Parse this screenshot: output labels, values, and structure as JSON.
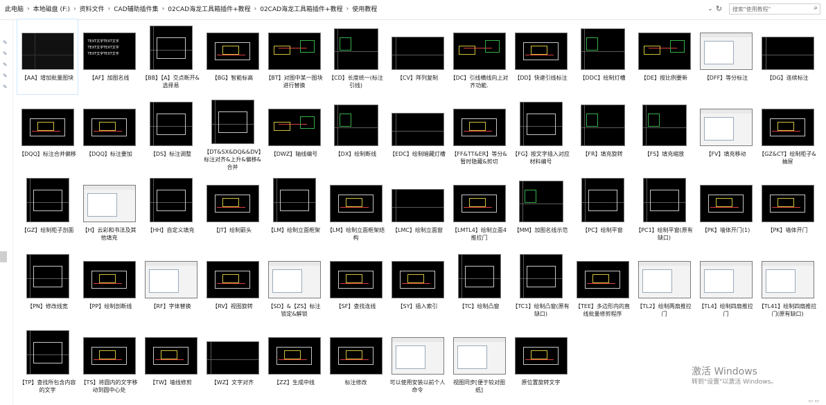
{
  "breadcrumb": [
    "此电脑",
    "本地磁盘 (F:)",
    "资料文件",
    "CAD辅助插件集",
    "02CAD海龙工具箱插件+教程",
    "02CAD海龙工具箱插件+教程",
    "使用教程"
  ],
  "search": {
    "placeholder": "搜索\"使用教程\""
  },
  "watermark": {
    "line1": "激活 Windows",
    "line2": "转到\"设置\"以激活 Windows。"
  },
  "files": [
    {
      "label": "【AA】增加批量图块",
      "kind": "grey"
    },
    {
      "label": "【AF】加图名线",
      "kind": "text"
    },
    {
      "label": "【BB】【A】交点断开&选择易",
      "kind": "tall"
    },
    {
      "label": "【BG】智能标高",
      "kind": "a"
    },
    {
      "label": "【BT】对图中某一图块进行替换",
      "kind": "b"
    },
    {
      "label": "【CD】长度统一(标注引线)",
      "kind": "c"
    },
    {
      "label": "【CV】阵列复制",
      "kind": "t1"
    },
    {
      "label": "【DC】引线横线向上对齐功能.",
      "kind": "b"
    },
    {
      "label": "【DD】快速引线标注",
      "kind": "a"
    },
    {
      "label": "【DDC】绘制灯槽",
      "kind": "c"
    },
    {
      "label": "【DE】按比例要新",
      "kind": "b"
    },
    {
      "label": "【DFF】等分标注",
      "kind": "ui"
    },
    {
      "label": "【DG】连续标注",
      "kind": "t1"
    },
    {
      "label": "【DQQ】标注合并偏移",
      "kind": "a"
    },
    {
      "label": "【DQQ】标注要加",
      "kind": "a"
    },
    {
      "label": "【DS】标注调整",
      "kind": "tall"
    },
    {
      "label": "【DT&SX&DQ&&DV】标注对齐&上升&偏移&合并",
      "kind": "tall"
    },
    {
      "label": "【DWZ】轴线编号",
      "kind": "b"
    },
    {
      "label": "【DX】绘制断线",
      "kind": "c"
    },
    {
      "label": "【EDC】绘制暗藏灯槽",
      "kind": "t1"
    },
    {
      "label": "【FF&TT&ER】等分&暂时隐藏&剪切",
      "kind": "a"
    },
    {
      "label": "【FG】按文字插入对应材料编号",
      "kind": "tall"
    },
    {
      "label": "【FR】填充旋转",
      "kind": "c"
    },
    {
      "label": "【FS】填充缩放",
      "kind": "c"
    },
    {
      "label": "【FV】填充移动",
      "kind": "ui"
    },
    {
      "label": "【GZ&CT】绘制柜子&抽屉",
      "kind": "a"
    },
    {
      "label": "【GZ】绘制柜子剖面",
      "kind": "tall"
    },
    {
      "label": "【H】云彩和书法及其他填充",
      "kind": "ui"
    },
    {
      "label": "【HH】自定义填充",
      "kind": "tall"
    },
    {
      "label": "【JT】绘制箭头",
      "kind": "a"
    },
    {
      "label": "【LM】绘制立面框架",
      "kind": "tall"
    },
    {
      "label": "【LM】绘制立面框架结构",
      "kind": "a"
    },
    {
      "label": "【LMC】绘制立面窗",
      "kind": "t1"
    },
    {
      "label": "【LMTL4】绘制立面4推拉门",
      "kind": "a"
    },
    {
      "label": "【MM】加图名线示范",
      "kind": "c"
    },
    {
      "label": "【PC】绘制平窗",
      "kind": "tall"
    },
    {
      "label": "【PC1】绘制平窗(原有缺口)",
      "kind": "tall"
    },
    {
      "label": "【PK】墙体开门(1)",
      "kind": "a"
    },
    {
      "label": "【PK】墙体开门",
      "kind": "a"
    },
    {
      "label": "【PN】修改线宽",
      "kind": "tall"
    },
    {
      "label": "【PP】绘制剖断线",
      "kind": "a"
    },
    {
      "label": "【RF】字体替换",
      "kind": "ui"
    },
    {
      "label": "【RV】视图旋转",
      "kind": "a"
    },
    {
      "label": "【SD】&【ZS】标注锁定&解锁",
      "kind": "ui"
    },
    {
      "label": "【SF】查找连线",
      "kind": "a"
    },
    {
      "label": "【SY】插入索引",
      "kind": "a"
    },
    {
      "label": "【TC】绘制凸窗",
      "kind": "tall"
    },
    {
      "label": "【TC1】绘制凸窗(原有缺口)",
      "kind": "tall"
    },
    {
      "label": "【TEE】多边形内的直线批量修剪程序",
      "kind": "a"
    },
    {
      "label": "【TL2】绘制两扇推拉门",
      "kind": "ui"
    },
    {
      "label": "【TL4】绘制四扇推拉门",
      "kind": "ui"
    },
    {
      "label": "【TL41】绘制四扇推拉门(原有缺口)",
      "kind": "ui"
    },
    {
      "label": "【TP】查找所包含内容的文字",
      "kind": "tall"
    },
    {
      "label": "【TS】将圆内的文字移动到圆中心处",
      "kind": "a"
    },
    {
      "label": "【TW】墙线修剪",
      "kind": "a"
    },
    {
      "label": "【WZ】文字对齐",
      "kind": "t1"
    },
    {
      "label": "【ZZ】生成中线",
      "kind": "a"
    },
    {
      "label": "标注修改",
      "kind": "a"
    },
    {
      "label": "可以使用安装以前个人命令",
      "kind": "ui"
    },
    {
      "label": "视图同步[便于较对图纸]",
      "kind": "ui"
    },
    {
      "label": "原位置旋转文字",
      "kind": "a"
    }
  ]
}
